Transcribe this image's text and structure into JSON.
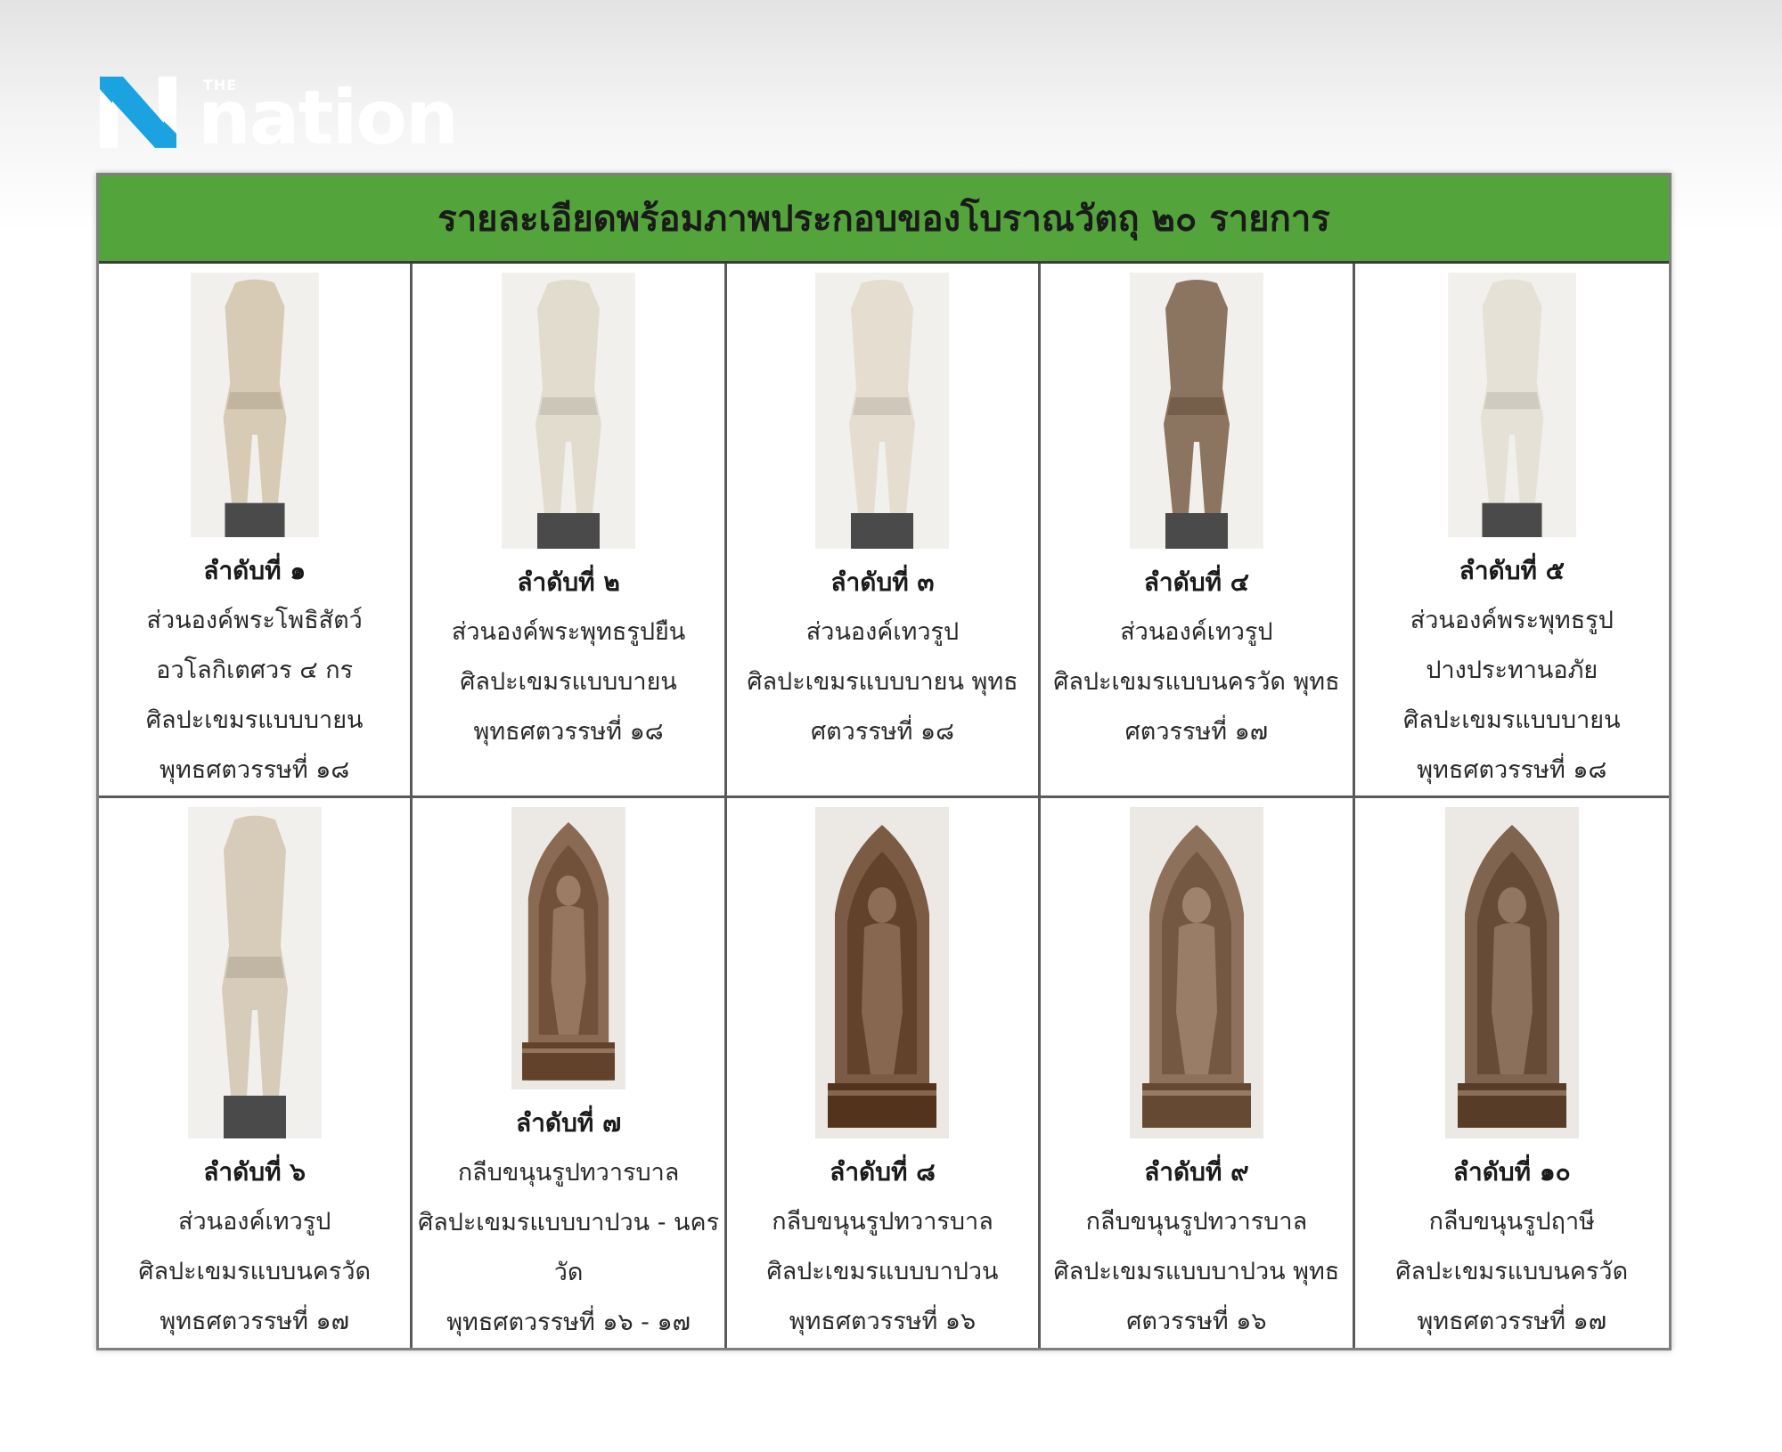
{
  "header": {
    "logo_the": "THE",
    "logo_word": "nation",
    "logo_icon": "nation-n-logo-icon"
  },
  "board": {
    "title": "รายละเอียดพร้อมภาพประกอบของโบราณวัตถุ ๒๐ รายการ",
    "header_color": "#54a43c",
    "items": [
      {
        "num": "ลำดับที่ ๑",
        "lines": [
          "ส่วนองค์พระโพธิสัตว์",
          "อวโลกิเตศวร ๔ กร",
          "ศิลปะเขมรแบบบายน",
          "พุทธศตวรรษที่ ๑๘"
        ],
        "icon": "statue-torso-image",
        "tone": "#d8cbb6"
      },
      {
        "num": "ลำดับที่ ๒",
        "lines": [
          "ส่วนองค์พระพุทธรูปยืน",
          "ศิลปะเขมรแบบบายน",
          "พุทธศตวรรษที่ ๑๘"
        ],
        "icon": "statue-torso-image",
        "tone": "#e2dccf"
      },
      {
        "num": "ลำดับที่ ๓",
        "lines": [
          "ส่วนองค์เทวรูป",
          "ศิลปะเขมรแบบบายน พุทธ",
          "ศตวรรษที่ ๑๘"
        ],
        "icon": "statue-torso-image",
        "tone": "#e4ddd0"
      },
      {
        "num": "ลำดับที่ ๔",
        "lines": [
          "ส่วนองค์เทวรูป",
          "ศิลปะเขมรแบบนครวัด พุทธ",
          "ศตวรรษที่ ๑๗"
        ],
        "icon": "statue-torso-image",
        "tone": "#8c7560"
      },
      {
        "num": "ลำดับที่ ๕",
        "lines": [
          "ส่วนองค์พระพุทธรูป",
          "ปางประทานอภัย",
          "ศิลปะเขมรแบบบายน",
          "พุทธศตวรรษที่ ๑๘"
        ],
        "icon": "statue-torso-image",
        "tone": "#e6e1d7"
      },
      {
        "num": "ลำดับที่ ๖",
        "lines": [
          "ส่วนองค์เทวรูป",
          "ศิลปะเขมรแบบนครวัด",
          "พุทธศตวรรษที่ ๑๗"
        ],
        "icon": "statue-torso-image",
        "tone": "#d7cbba"
      },
      {
        "num": "ลำดับที่ ๗",
        "lines": [
          "กลีบขนุนรูปทวารบาล",
          "ศิลปะเขมรแบบบาปวน - นครวัด",
          "พุทธศตวรรษที่ ๑๖ - ๑๗"
        ],
        "icon": "carved-stele-image",
        "tone": "#8a6a52"
      },
      {
        "num": "ลำดับที่ ๘",
        "lines": [
          "กลีบขนุนรูปทวารบาล",
          "ศิลปะเขมรแบบบาปวน",
          "พุทธศตวรรษที่ ๑๖"
        ],
        "icon": "carved-stele-image",
        "tone": "#7c5b45"
      },
      {
        "num": "ลำดับที่ ๙",
        "lines": [
          "กลีบขนุนรูปทวารบาล",
          "ศิลปะเขมรแบบบาปวน พุทธ",
          "ศตวรรษที่ ๑๖"
        ],
        "icon": "carved-stele-image",
        "tone": "#8e715b"
      },
      {
        "num": "ลำดับที่ ๑๐",
        "lines": [
          "กลีบขนุนรูปฤาษี",
          "ศิลปะเขมรแบบนครวัด",
          "พุทธศตวรรษที่ ๑๗"
        ],
        "icon": "carved-stele-image",
        "tone": "#7f6450"
      }
    ]
  }
}
